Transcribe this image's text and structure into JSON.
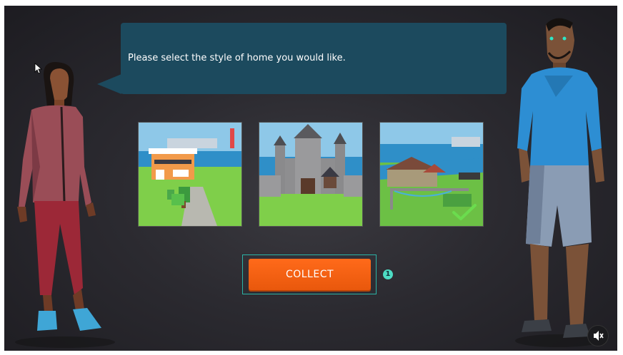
{
  "dialog": {
    "message": "Please select the style of home you would like."
  },
  "options": [
    {
      "name": "modern-house",
      "selected": false
    },
    {
      "name": "castle",
      "selected": false
    },
    {
      "name": "village",
      "selected": true
    }
  ],
  "collect": {
    "label": "COLLECT",
    "badge": "1"
  },
  "colors": {
    "bubble": "#1c4a5e",
    "button": "#ff6a1a",
    "accent": "#2bb3a6",
    "check": "#6bdc4e"
  },
  "icons": {
    "mute": "speaker-muted-icon",
    "selected": "checkmark-icon"
  }
}
